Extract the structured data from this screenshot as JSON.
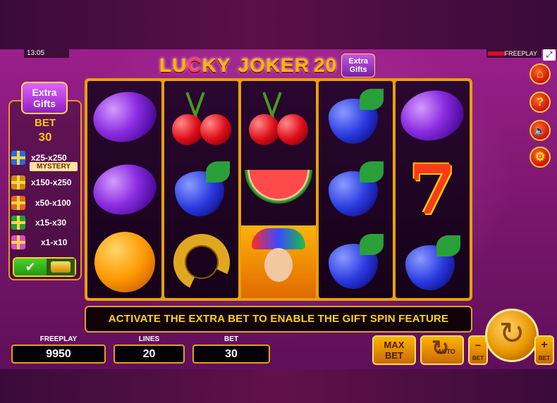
{
  "status": {
    "time": "13:05",
    "mode": "FREEPLAY"
  },
  "title": {
    "word1_a": "LU",
    "word1_c": "C",
    "word1_b": "KY",
    "word2": "JOKER",
    "number": "20",
    "badge_line1": "Extra",
    "badge_line2": "Gifts"
  },
  "side_panel": {
    "badge_line1": "Extra",
    "badge_line2": "Gifts",
    "bet_label": "BET",
    "bet_value": "30",
    "mystery_label": "MYSTERY",
    "gifts": [
      {
        "icon": "gift-blue-icon",
        "range": "x25-x250"
      },
      {
        "icon": "gift-gold-icon",
        "range": "x150-x250"
      },
      {
        "icon": "gift-orange-icon",
        "range": "x50-x100"
      },
      {
        "icon": "gift-green-icon",
        "range": "x15-x30"
      },
      {
        "icon": "gift-pink-icon",
        "range": "x1-x10"
      }
    ],
    "toggle_on_glyph": "✔"
  },
  "reels": [
    [
      "plum",
      "plum",
      "orange"
    ],
    [
      "cherry",
      "grapes",
      "horseshoe"
    ],
    [
      "cherry",
      "watermelon",
      "joker"
    ],
    [
      "grapes",
      "grapes",
      "grapes"
    ],
    [
      "plum",
      "seven",
      "grapes"
    ]
  ],
  "message": "ACTIVATE THE EXTRA BET TO ENABLE THE GIFT SPIN FEATURE",
  "footer": {
    "freeplay_label": "FREEPLAY",
    "freeplay_value": "9950",
    "lines_label": "LINES",
    "lines_value": "20",
    "bet_label": "BET",
    "bet_value": "30"
  },
  "controls": {
    "maxbet_line1": "MAX",
    "maxbet_line2": "BET",
    "auto_label": "AUTO",
    "minus_glyph": "−",
    "plus_glyph": "+",
    "bet_small_label": "BET",
    "spin_glyph": "↻"
  },
  "side_menu": {
    "home_glyph": "⌂",
    "help_glyph": "?",
    "sound_glyph": "🔈",
    "settings_glyph": "⚙"
  },
  "window_button_glyph": "⤢",
  "colors": {
    "accent_gold": "#e8a00a",
    "message_text": "#ffd21a",
    "background_purple": "#7d176f"
  }
}
